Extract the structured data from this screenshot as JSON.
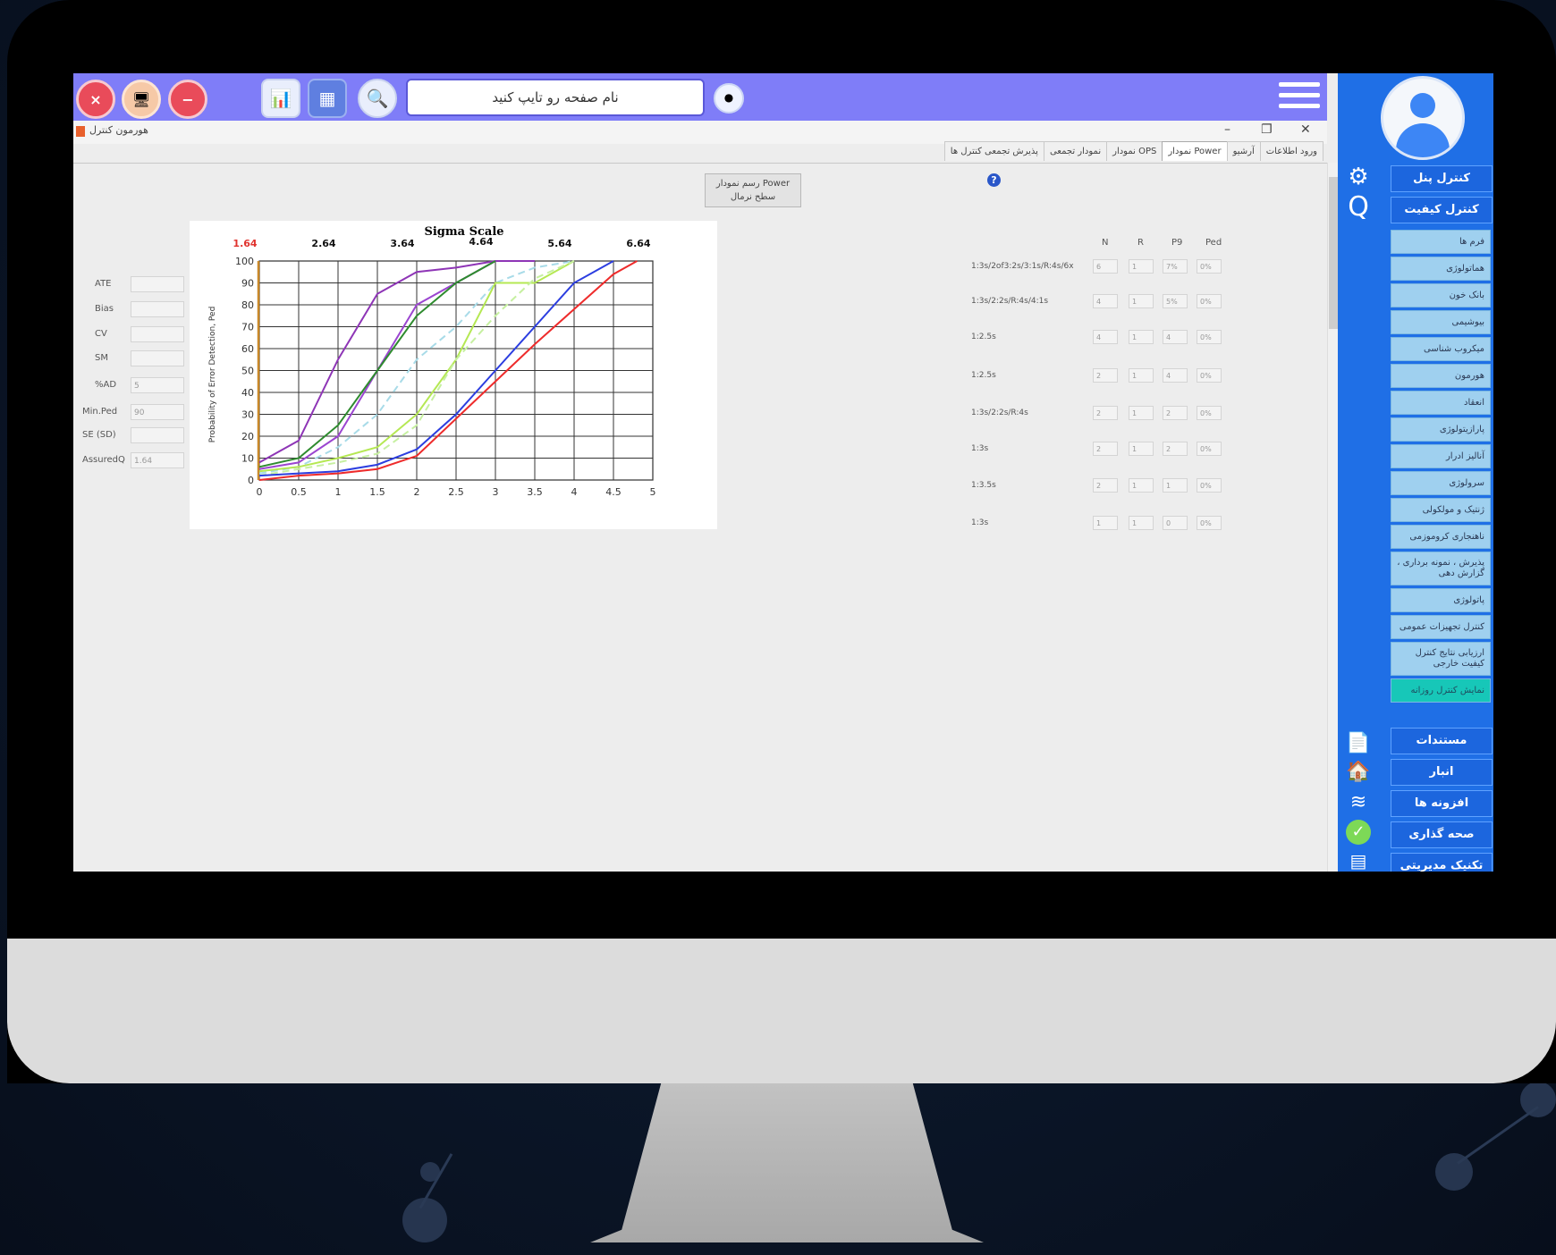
{
  "topbar": {
    "page_name_placeholder": "نام صفحه رو تایپ کنید"
  },
  "window": {
    "title": "هورمون کنترل",
    "minimize": "–",
    "restore": "❐",
    "close": "✕"
  },
  "tabs": [
    {
      "label": "ورود اطلاعات",
      "active": false
    },
    {
      "label": "آرشیو",
      "active": false
    },
    {
      "label": "نمودار Power",
      "active": true
    },
    {
      "label": "نمودار OPS",
      "active": false
    },
    {
      "label": "نمودار تجمعی",
      "active": false
    },
    {
      "label": "پذیرش تجمعی کنترل ها",
      "active": false
    }
  ],
  "left_fields": [
    {
      "label": "ATE",
      "value": ""
    },
    {
      "label": "Bias",
      "value": ""
    },
    {
      "label": "CV",
      "value": ""
    },
    {
      "label": "SM",
      "value": ""
    },
    {
      "label": "%AD",
      "value": "5"
    },
    {
      "label": "Min.Ped",
      "value": "90"
    },
    {
      "label": "SE (SD)",
      "value": ""
    },
    {
      "label": "AssuredQ",
      "value": "1.64"
    }
  ],
  "draw_button": {
    "line1": "رسم نمودار Power",
    "line2": "سطح نرمال"
  },
  "help_icon": "?",
  "table": {
    "headers": [
      "N",
      "R",
      "P9",
      "Ped"
    ],
    "rows": [
      {
        "rule": "1:3s/2of3:2s/3:1s/R:4s/6x",
        "N": "6",
        "R": "1",
        "P9": "7%",
        "Ped": "0%"
      },
      {
        "rule": "1:3s/2:2s/R:4s/4:1s",
        "N": "4",
        "R": "1",
        "P9": "5%",
        "Ped": "0%"
      },
      {
        "rule": "1:2.5s",
        "N": "4",
        "R": "1",
        "P9": "4",
        "Ped": "0%"
      },
      {
        "rule": "1:2.5s",
        "N": "2",
        "R": "1",
        "P9": "4",
        "Ped": "0%"
      },
      {
        "rule": "1:3s/2:2s/R:4s",
        "N": "2",
        "R": "1",
        "P9": "2",
        "Ped": "0%"
      },
      {
        "rule": "1:3s",
        "N": "2",
        "R": "1",
        "P9": "2",
        "Ped": "0%"
      },
      {
        "rule": "1:3.5s",
        "N": "2",
        "R": "1",
        "P9": "1",
        "Ped": "0%"
      },
      {
        "rule": "1:3s",
        "N": "1",
        "R": "1",
        "P9": "0",
        "Ped": "0%"
      }
    ]
  },
  "sidebar": {
    "main_top": [
      {
        "label": "کنترل پنل"
      },
      {
        "label": "کنترل کیفیت"
      }
    ],
    "sub_items": [
      {
        "label": "فرم ها",
        "active": false
      },
      {
        "label": "هماتولوژی",
        "active": false
      },
      {
        "label": "بانک خون",
        "active": false
      },
      {
        "label": "بیوشیمی",
        "active": false
      },
      {
        "label": "میکروب شناسی",
        "active": false
      },
      {
        "label": "هورمون",
        "active": false
      },
      {
        "label": "انعقاد",
        "active": false
      },
      {
        "label": "پارازیتولوژی",
        "active": false
      },
      {
        "label": "آنالیز ادرار",
        "active": false
      },
      {
        "label": "سرولوژی",
        "active": false
      },
      {
        "label": "ژنتیک و مولکولی",
        "active": false
      },
      {
        "label": "ناهنجاری کروموزمی",
        "active": false
      },
      {
        "label": "پذیرش ، نمونه برداری ، گزارش دهی",
        "active": false
      },
      {
        "label": "پاتولوژی",
        "active": false
      },
      {
        "label": "کنترل تجهیزات عمومی",
        "active": false
      },
      {
        "label": "ارزیابی نتایج کنترل کیفیت خارجی",
        "active": false
      },
      {
        "label": "نمایش کنترل روزانه",
        "active": true
      }
    ],
    "main_bottom": [
      {
        "label": "مستندات"
      },
      {
        "label": "انبار"
      },
      {
        "label": "افزونه ها"
      },
      {
        "label": "صحه گذاری"
      },
      {
        "label": "تکنیک مدیریتی"
      }
    ]
  },
  "chart_data": {
    "type": "line",
    "title": "Sigma Scale",
    "ylabel": "Probability of Error Detection, Ped",
    "xlabel": "",
    "xlim": [
      0,
      5
    ],
    "ylim": [
      0,
      100
    ],
    "x_ticks": [
      0,
      0.5,
      1,
      1.5,
      2,
      2.5,
      3,
      3.5,
      4,
      4.5,
      5
    ],
    "y_ticks": [
      0,
      10,
      20,
      30,
      40,
      50,
      60,
      70,
      80,
      90,
      100
    ],
    "sigma_ticks": [
      {
        "x": 0,
        "label": "1.64"
      },
      {
        "x": 1,
        "label": "2.64"
      },
      {
        "x": 2,
        "label": "3.64"
      },
      {
        "x": 3,
        "label": "4.64"
      },
      {
        "x": 4,
        "label": "5.64"
      },
      {
        "x": 5,
        "label": "6.64"
      }
    ],
    "grid": true,
    "series": [
      {
        "color": "#8e35b6",
        "dash": false,
        "x": [
          0,
          0.5,
          1,
          1.5,
          2,
          2.5,
          3,
          3.5
        ],
        "y": [
          8,
          18,
          55,
          85,
          95,
          97,
          100,
          100
        ]
      },
      {
        "color": "#9b45d0",
        "dash": false,
        "x": [
          0,
          0.5,
          1,
          1.5,
          2,
          2.5,
          3
        ],
        "y": [
          5,
          8,
          20,
          50,
          80,
          90,
          100
        ]
      },
      {
        "color": "#2e8b2e",
        "dash": false,
        "x": [
          0,
          0.5,
          1,
          1.5,
          2,
          2.5,
          3
        ],
        "y": [
          6,
          10,
          25,
          50,
          75,
          90,
          100
        ]
      },
      {
        "color": "#a8dbe8",
        "dash": true,
        "x": [
          0,
          0.5,
          1,
          1.5,
          2,
          2.5,
          3,
          3.5,
          4
        ],
        "y": [
          3,
          6,
          15,
          30,
          55,
          70,
          90,
          97,
          100
        ]
      },
      {
        "color": "#b5e853",
        "dash": false,
        "x": [
          0,
          0.5,
          1,
          1.5,
          2,
          2.5,
          3,
          3.5,
          4
        ],
        "y": [
          4,
          6,
          10,
          15,
          30,
          55,
          90,
          90,
          100
        ]
      },
      {
        "color": "#c6f0a0",
        "dash": true,
        "x": [
          0,
          0.5,
          1,
          1.5,
          2,
          2.5,
          3,
          3.5,
          4
        ],
        "y": [
          2,
          5,
          8,
          12,
          25,
          55,
          75,
          92,
          100
        ]
      },
      {
        "color": "#2c3ee0",
        "dash": false,
        "x": [
          0,
          0.5,
          1,
          1.5,
          2,
          2.5,
          3,
          3.5,
          4,
          4.5
        ],
        "y": [
          2,
          3,
          4,
          7,
          14,
          30,
          50,
          70,
          90,
          100
        ]
      },
      {
        "color": "#ee2b2b",
        "dash": false,
        "x": [
          0,
          0.5,
          1,
          1.5,
          2,
          2.5,
          3,
          3.5,
          4,
          4.5,
          4.8
        ],
        "y": [
          0,
          2,
          3,
          5,
          11,
          28,
          45,
          62,
          78,
          94,
          100
        ]
      }
    ]
  },
  "colors": {
    "topbar": "#7f7df8",
    "sidebar": "#1f6fe6",
    "sub_item": "#9fd0ef",
    "active_item": "#17c7b8",
    "sigma_first_tick": "#e0342f"
  }
}
